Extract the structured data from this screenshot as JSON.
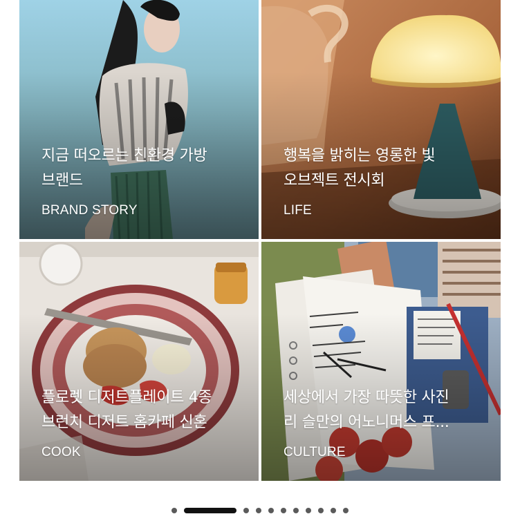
{
  "cards": [
    {
      "title_line1": "지금 떠오르는 친환경 가방",
      "title_line2": "브랜드",
      "category": "BRAND STORY",
      "image": "woman-with-knit-shawl-and-green-bag-photo"
    },
    {
      "title_line1": "행복을 밝히는 영롱한 빛",
      "title_line2": "오브젝트 전시회",
      "category": "LIFE",
      "image": "mushroom-table-lamp-photo"
    },
    {
      "title_line1": "플로렛 디저트플레이트 4종",
      "title_line2": "브런치 디저트 홈카페 신혼",
      "category": "COOK",
      "image": "scone-on-floral-plate-photo"
    },
    {
      "title_line1": "세상에서 가장 따뜻한 사진",
      "title_line2": "리 슬만의 어노니머스 프...",
      "category": "CULTURE",
      "image": "collage-notebook-photo"
    }
  ],
  "pager": {
    "total": 11,
    "active_index": 1
  },
  "colors": {
    "text_on_image": "#ffffff",
    "pager_active": "#111111",
    "pager_inactive": "#5a5a5a"
  }
}
